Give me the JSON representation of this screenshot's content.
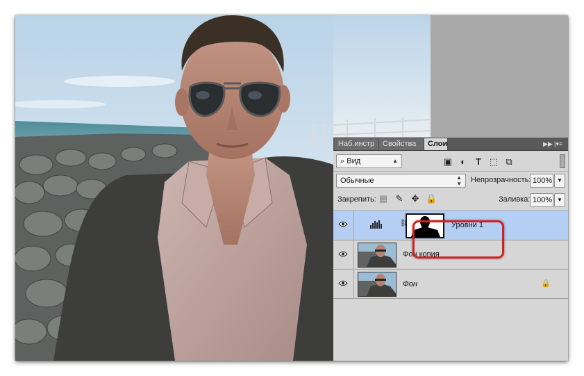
{
  "panel": {
    "tabs": [
      {
        "label": "Наб.инстр",
        "active": false
      },
      {
        "label": "Свойства",
        "active": false
      },
      {
        "label": "Слои",
        "active": true
      }
    ],
    "filter_kind": "Вид",
    "blend_mode": "Обычные",
    "opacity_label": "Непрозрачность:",
    "opacity_value": "100%",
    "lock_label": "Закрепить:",
    "fill_label": "Заливка:",
    "fill_value": "100%",
    "layers": [
      {
        "name": "Уровни 1",
        "type": "adjustment-levels",
        "selected": true,
        "visible": true,
        "locked": false
      },
      {
        "name": "Фон копия",
        "type": "pixel",
        "selected": false,
        "visible": true,
        "locked": false
      },
      {
        "name": "Фон",
        "type": "pixel",
        "selected": false,
        "visible": true,
        "locked": true
      }
    ]
  },
  "icons": {
    "filter_search": "search-icon",
    "filter_types": [
      "image-filter-icon",
      "adjustment-filter-icon",
      "text-filter-icon",
      "shape-filter-icon",
      "smart-object-filter-icon"
    ],
    "lock_types": [
      "lock-transparent-icon",
      "lock-paint-icon",
      "lock-move-icon",
      "lock-all-icon"
    ],
    "panel_menu": "panel-menu-icon",
    "collapse": "collapse-arrows-icon"
  },
  "colors": {
    "selection_highlight": "#b5cef3",
    "callout_red": "#d5201f",
    "panel_bg": "#d6d6d6",
    "tabbar_bg": "#595959"
  }
}
